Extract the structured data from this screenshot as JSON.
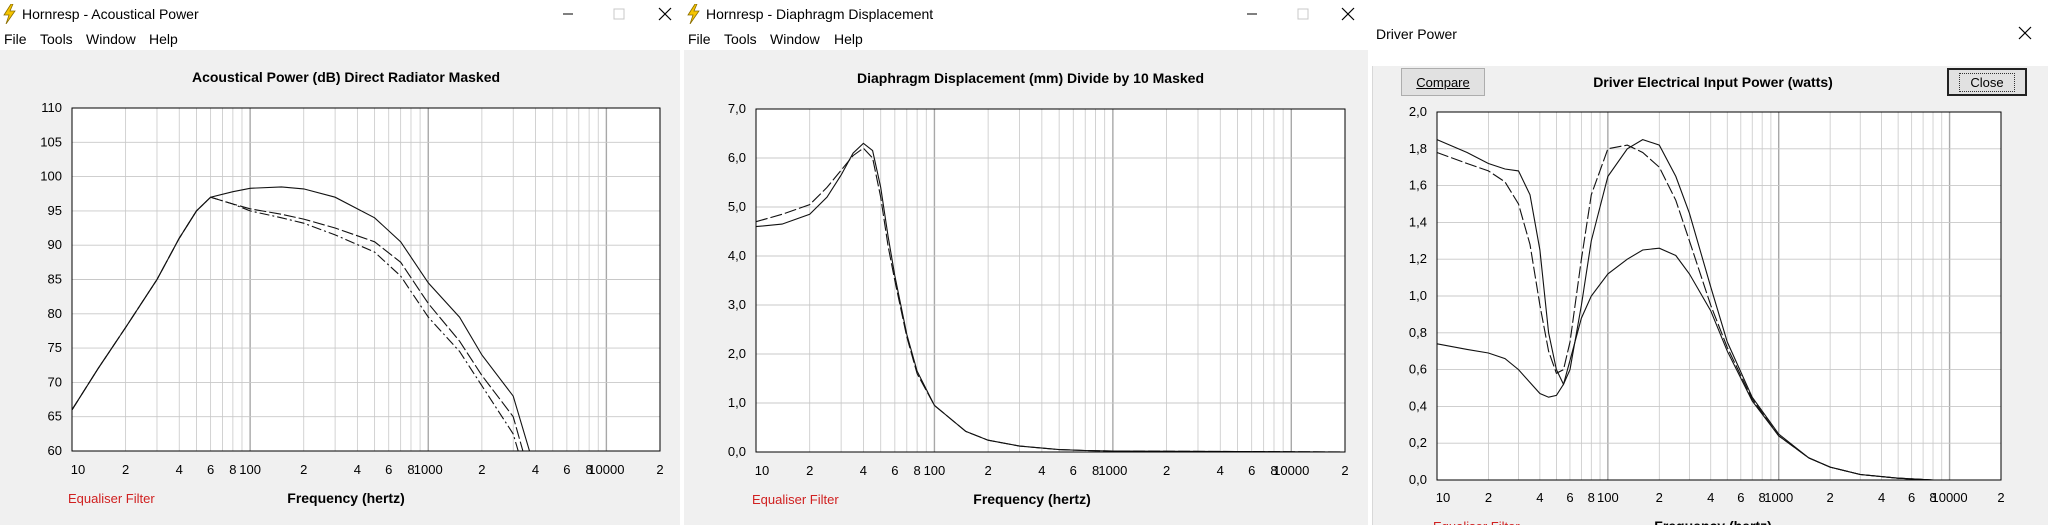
{
  "windows": {
    "acoustical_power": {
      "title": "Hornresp - Acoustical Power",
      "menu": [
        "File",
        "Tools",
        "Window",
        "Help"
      ]
    },
    "diaphragm_displacement": {
      "title": "Hornresp - Diaphragm Displacement",
      "menu": [
        "File",
        "Tools",
        "Window",
        "Help"
      ]
    },
    "driver_power": {
      "title": "Driver Power",
      "compare_label": "Compare",
      "close_label": "Close"
    }
  },
  "colors": {
    "curve": "#111111",
    "grid": "#c8c8c8",
    "grid_major": "#a8a8a8",
    "equaliser_text": "#d02020",
    "plot_bg": "#ffffff",
    "window_bg": "#f0f0f0"
  },
  "chart_data": [
    {
      "type": "line",
      "title": "Acoustical Power (dB)    Direct Radiator    Masked",
      "xlabel": "Frequency (hertz)",
      "xscale": "log",
      "xlim": [
        10,
        20000
      ],
      "ylim": [
        60,
        110
      ],
      "x_tick_labels": [
        "10",
        "2",
        "4",
        "6",
        "8",
        "100",
        "2",
        "4",
        "6",
        "8",
        "1000",
        "2",
        "4",
        "6",
        "8",
        "10000",
        "2"
      ],
      "y_tick_labels": [
        "110",
        "105",
        "100",
        "95",
        "90",
        "85",
        "80",
        "75",
        "70",
        "65",
        "60"
      ],
      "footer_label": "Equaliser Filter",
      "grid": true,
      "series": [
        {
          "style": "solid",
          "x": [
            10,
            14,
            20,
            30,
            40,
            50,
            60,
            80,
            100,
            150,
            200,
            300,
            500,
            700,
            1000,
            1500,
            2000,
            3000,
            3700
          ],
          "y": [
            66,
            72,
            78,
            85,
            91,
            95,
            97,
            97.8,
            98.3,
            98.5,
            98.2,
            97,
            94,
            90.5,
            84.5,
            79.5,
            74,
            68,
            60
          ]
        },
        {
          "style": "dashed",
          "x": [
            10,
            14,
            20,
            30,
            40,
            50,
            60,
            80,
            100,
            150,
            200,
            300,
            500,
            700,
            1000,
            1500,
            2000,
            3000,
            3400
          ],
          "y": [
            66,
            72,
            78,
            85,
            91,
            95,
            97,
            96,
            95.3,
            94.5,
            93.8,
            92.5,
            90.5,
            87.5,
            81.5,
            76,
            71,
            65,
            60
          ]
        },
        {
          "style": "dashdot",
          "x": [
            10,
            14,
            20,
            30,
            40,
            50,
            60,
            80,
            100,
            150,
            200,
            300,
            500,
            700,
            1000,
            1500,
            2000,
            3000,
            3200
          ],
          "y": [
            66,
            72,
            78,
            85,
            91,
            95,
            97,
            96,
            95,
            94,
            93.2,
            91.5,
            89,
            85.5,
            79.5,
            74.5,
            69.5,
            62.5,
            60
          ]
        }
      ]
    },
    {
      "type": "line",
      "title": "Diaphragm Displacement (mm)    Divide by 10    Masked",
      "xlabel": "Frequency (hertz)",
      "xscale": "log",
      "xlim": [
        10,
        20000
      ],
      "ylim": [
        0,
        7
      ],
      "x_tick_labels": [
        "10",
        "2",
        "4",
        "6",
        "8",
        "100",
        "2",
        "4",
        "6",
        "8",
        "1000",
        "2",
        "4",
        "6",
        "8",
        "10000",
        "2"
      ],
      "y_tick_labels": [
        "7,0",
        "6,0",
        "5,0",
        "4,0",
        "3,0",
        "2,0",
        "1,0",
        "0,0"
      ],
      "footer_label": "Equaliser Filter",
      "grid": true,
      "series": [
        {
          "style": "solid",
          "x": [
            10,
            14,
            20,
            25,
            30,
            35,
            40,
            45,
            50,
            55,
            60,
            70,
            80,
            100,
            150,
            200,
            300,
            500,
            700,
            1000,
            20000
          ],
          "y": [
            4.6,
            4.65,
            4.85,
            5.2,
            5.65,
            6.1,
            6.3,
            6.15,
            5.4,
            4.4,
            3.6,
            2.4,
            1.65,
            0.95,
            0.42,
            0.24,
            0.12,
            0.05,
            0.03,
            0.02,
            0.0
          ]
        },
        {
          "style": "dashed",
          "x": [
            10,
            14,
            20,
            25,
            30,
            35,
            40,
            45,
            50,
            55,
            60,
            70,
            80,
            100,
            150,
            200,
            300,
            500,
            700,
            1000,
            20000
          ],
          "y": [
            4.7,
            4.85,
            5.05,
            5.4,
            5.75,
            6.05,
            6.2,
            6.0,
            5.2,
            4.2,
            3.5,
            2.35,
            1.6,
            0.95,
            0.42,
            0.24,
            0.12,
            0.05,
            0.03,
            0.02,
            0.0
          ]
        }
      ]
    },
    {
      "type": "line",
      "title": "Driver Electrical Input Power (watts)",
      "xlabel": "Frequency (hertz)",
      "xscale": "log",
      "xlim": [
        10,
        20000
      ],
      "ylim": [
        0,
        2.0
      ],
      "x_tick_labels": [
        "10",
        "2",
        "4",
        "6",
        "8",
        "100",
        "2",
        "4",
        "6",
        "8",
        "1000",
        "2",
        "4",
        "6",
        "8",
        "10000",
        "2"
      ],
      "y_tick_labels": [
        "2,0",
        "1,8",
        "1,6",
        "1,4",
        "1,2",
        "1,0",
        "0,8",
        "0,6",
        "0,4",
        "0,2",
        "0,0"
      ],
      "footer_label": "Equaliser Filter",
      "grid": true,
      "series": [
        {
          "style": "solid",
          "x": [
            10,
            15,
            20,
            25,
            30,
            35,
            40,
            45,
            50,
            55,
            60,
            70,
            80,
            100,
            130,
            160,
            200,
            250,
            300,
            400,
            500,
            700,
            1000,
            1500,
            2000,
            3000,
            5000,
            8000
          ],
          "y": [
            1.85,
            1.78,
            1.72,
            1.69,
            1.68,
            1.55,
            1.25,
            0.8,
            0.6,
            0.52,
            0.6,
            0.95,
            1.3,
            1.65,
            1.8,
            1.85,
            1.82,
            1.65,
            1.45,
            1.05,
            0.75,
            0.45,
            0.25,
            0.12,
            0.07,
            0.03,
            0.01,
            0.0
          ]
        },
        {
          "style": "dashed",
          "x": [
            10,
            15,
            20,
            25,
            30,
            35,
            40,
            45,
            50,
            55,
            60,
            70,
            80,
            100,
            130,
            160,
            200,
            250,
            300,
            400,
            500,
            700,
            1000,
            1500,
            2000,
            3000,
            5000,
            8000
          ],
          "y": [
            1.78,
            1.72,
            1.68,
            1.62,
            1.5,
            1.28,
            0.95,
            0.7,
            0.58,
            0.6,
            0.75,
            1.2,
            1.55,
            1.8,
            1.82,
            1.78,
            1.7,
            1.52,
            1.3,
            0.95,
            0.72,
            0.44,
            0.24,
            0.12,
            0.07,
            0.03,
            0.01,
            0.0
          ]
        },
        {
          "style": "solid",
          "x": [
            10,
            15,
            20,
            25,
            30,
            35,
            40,
            45,
            50,
            55,
            60,
            70,
            80,
            100,
            130,
            160,
            200,
            250,
            300,
            400,
            500,
            700,
            1000,
            1500,
            2000,
            3000,
            5000,
            8000
          ],
          "y": [
            0.74,
            0.71,
            0.69,
            0.66,
            0.6,
            0.53,
            0.47,
            0.45,
            0.46,
            0.52,
            0.65,
            0.88,
            1.0,
            1.12,
            1.2,
            1.25,
            1.26,
            1.22,
            1.12,
            0.92,
            0.7,
            0.43,
            0.24,
            0.12,
            0.07,
            0.03,
            0.01,
            0.0
          ]
        }
      ]
    }
  ]
}
